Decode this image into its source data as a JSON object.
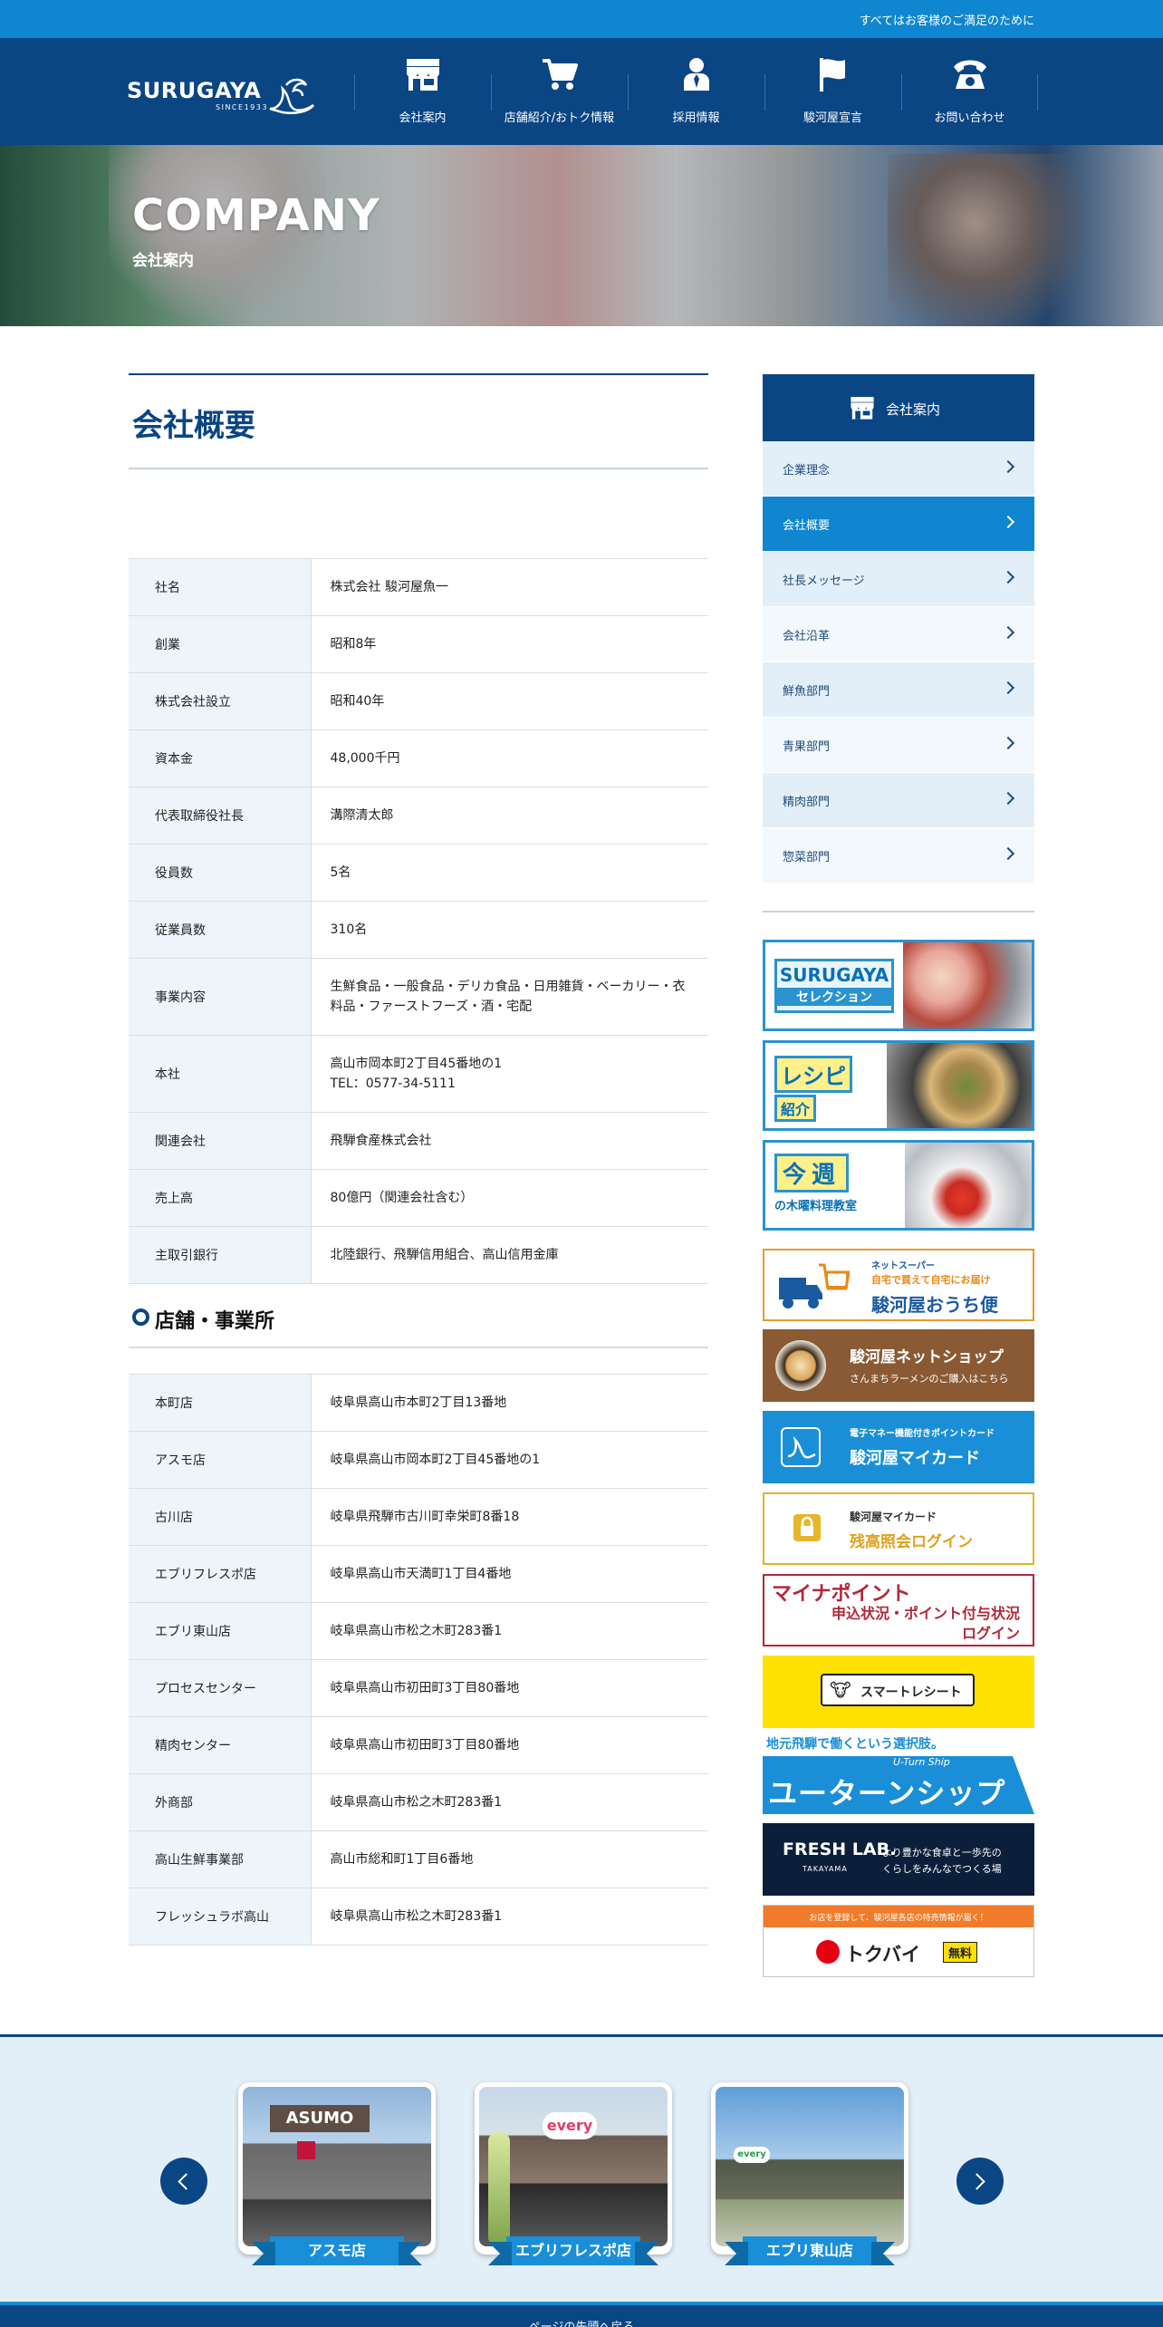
{
  "topbar": {
    "tagline": "すべてはお客様のご満足のために"
  },
  "header": {
    "logo_text": "SURUGAYA",
    "logo_since": "SINCE1933",
    "nav": [
      {
        "label": "会社案内",
        "icon": "store-icon"
      },
      {
        "label": "店舗紹介/おトク情報",
        "icon": "cart-icon"
      },
      {
        "label": "採用情報",
        "icon": "person-icon"
      },
      {
        "label": "駿河屋宣言",
        "icon": "flag-icon"
      },
      {
        "label": "お問い合わせ",
        "icon": "telephone-icon"
      }
    ]
  },
  "hero": {
    "title": "COMPANY",
    "subtitle": "会社案内"
  },
  "main": {
    "title": "会社概要",
    "company_rows": [
      {
        "label": "社名",
        "value": "株式会社 駿河屋魚一"
      },
      {
        "label": "創業",
        "value": "昭和8年"
      },
      {
        "label": "株式会社設立",
        "value": "昭和40年"
      },
      {
        "label": "資本金",
        "value": "48,000千円"
      },
      {
        "label": "代表取締役社長",
        "value": "溝際清太郎"
      },
      {
        "label": "役員数",
        "value": "5名"
      },
      {
        "label": "従業員数",
        "value": "310名"
      },
      {
        "label": "事業内容",
        "value": "生鮮食品・一般食品・デリカ食品・日用雑貨・ベーカリー・衣料品・ファーストフーズ・酒・宅配"
      },
      {
        "label": "本社",
        "value": "高山市岡本町2丁目45番地の1",
        "value2": "TEL：0577-34-5111"
      },
      {
        "label": "関連会社",
        "value": "飛騨食産株式会社"
      },
      {
        "label": "売上高",
        "value": "80億円（関連会社含む）"
      },
      {
        "label": "主取引銀行",
        "value": "北陸銀行、飛騨信用組合、高山信用金庫"
      }
    ],
    "stores_heading": "店舗・事業所",
    "store_rows": [
      {
        "label": "本町店",
        "value": "岐阜県高山市本町2丁目13番地"
      },
      {
        "label": "アスモ店",
        "value": "岐阜県高山市岡本町2丁目45番地の1"
      },
      {
        "label": "古川店",
        "value": "岐阜県飛騨市古川町幸栄町8番18"
      },
      {
        "label": "エブリフレスポ店",
        "value": "岐阜県高山市天満町1丁目4番地"
      },
      {
        "label": "エブリ東山店",
        "value": "岐阜県高山市松之木町283番1"
      },
      {
        "label": "プロセスセンター",
        "value": "岐阜県高山市初田町3丁目80番地"
      },
      {
        "label": "精肉センター",
        "value": "岐阜県高山市初田町3丁目80番地"
      },
      {
        "label": "外商部",
        "value": "岐阜県高山市松之木町283番1"
      },
      {
        "label": "高山生鮮事業部",
        "value": "高山市総和町1丁目6番地"
      },
      {
        "label": "フレッシュラボ高山",
        "value": "岐阜県高山市松之木町283番1"
      }
    ]
  },
  "sidebar": {
    "heading": "会社案内",
    "items": [
      {
        "label": "企業理念"
      },
      {
        "label": "会社概要"
      },
      {
        "label": "社長メッセージ"
      },
      {
        "label": "会社沿革"
      },
      {
        "label": "鮮魚部門"
      },
      {
        "label": "青果部門"
      },
      {
        "label": "精肉部門"
      },
      {
        "label": "惣菜部門"
      }
    ],
    "banners": {
      "selection": {
        "line1": "SURUGAYA",
        "line2": "セレクション"
      },
      "recipe": {
        "line1": "レシピ",
        "line2": "紹介"
      },
      "cooking": {
        "line1": "今週",
        "line2": "の木曜料理教室"
      },
      "ouchibin": {
        "line1": "ネットスーパー",
        "line2": "自宅で買えて自宅にお届け",
        "line3": "駿河屋おうち便"
      },
      "netshop": {
        "line1": "駿河屋ネットショップ",
        "line2": "さんまちラーメンのご購入はこちら"
      },
      "mycard": {
        "line1": "電子マネー機能付きポイントカード",
        "line2": "駿河屋マイカード"
      },
      "balance": {
        "line1": "駿河屋マイカード",
        "line2": "残高照会ログイン"
      },
      "myna": {
        "line1": "マイナポイント",
        "line2": "申込状況・ポイント付与状況",
        "line3": "ログイン"
      },
      "smartreceipt": {
        "line1": "スマートレシート"
      },
      "uturn": {
        "line1": "地元飛騨で働くという選択肢。",
        "line2": "U-Turn Ship",
        "line3": "ユーターンシップ"
      },
      "freshlab": {
        "line1": "FRESH LAB.",
        "line2": "TAKAYAMA",
        "line3": "より豊かな食卓と一歩先の",
        "line4": "くらしをみんなでつくる場"
      },
      "tokubai": {
        "line1": "お店を登録して、駿河屋各店の特売情報が届く！",
        "line2": "トクバイ",
        "line3": "無料"
      }
    }
  },
  "carousel": {
    "stores": [
      {
        "label": "アスモ店",
        "sign": "ASUMO"
      },
      {
        "label": "エブリフレスポ店",
        "sign": "every"
      },
      {
        "label": "エブリ東山店",
        "sign": "every"
      }
    ]
  },
  "pagetop": {
    "label": "ページの先頭へ戻る"
  },
  "colors": {
    "navy": "#0a4584",
    "blue": "#0f86cf",
    "light": "#e3eff8"
  }
}
